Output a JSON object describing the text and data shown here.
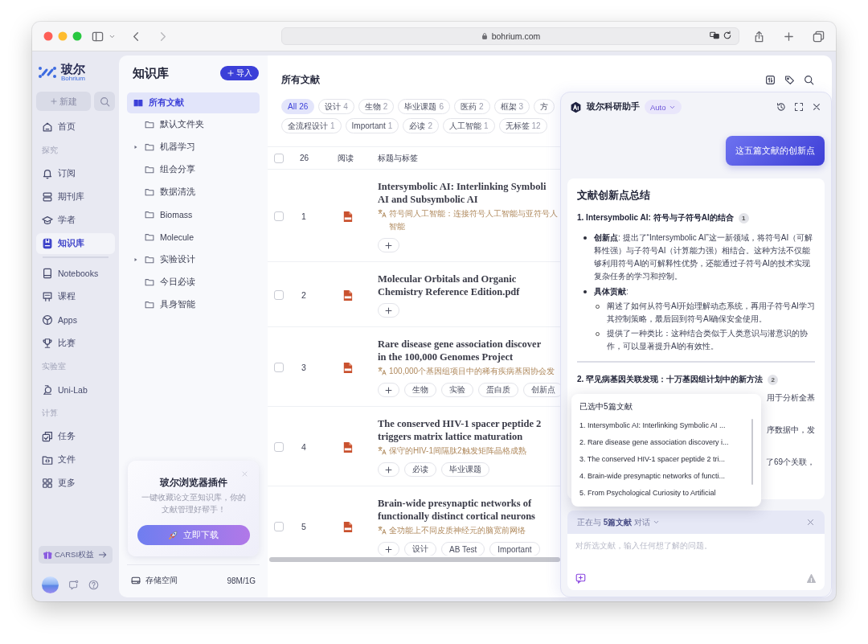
{
  "browser": {
    "url": "bohrium.com"
  },
  "nav": {
    "brand": "玻尔",
    "brand_sub": "Bohrium",
    "new_button": "新建",
    "items": [
      {
        "kind": "item",
        "label": "首页",
        "selected": false
      },
      {
        "kind": "section",
        "label": "探究"
      },
      {
        "kind": "item",
        "label": "订阅",
        "selected": false
      },
      {
        "kind": "item",
        "label": "期刊库",
        "selected": false
      },
      {
        "kind": "item",
        "label": "学者",
        "selected": false
      },
      {
        "kind": "item",
        "label": "知识库",
        "selected": true
      },
      {
        "kind": "divider"
      },
      {
        "kind": "item",
        "label": "Notebooks",
        "selected": false
      },
      {
        "kind": "item",
        "label": "课程",
        "selected": false
      },
      {
        "kind": "item",
        "label": "Apps",
        "selected": false
      },
      {
        "kind": "item",
        "label": "比赛",
        "selected": false
      },
      {
        "kind": "section",
        "label": "实验室"
      },
      {
        "kind": "item",
        "label": "Uni-Lab",
        "selected": false
      },
      {
        "kind": "section",
        "label": "计算"
      },
      {
        "kind": "item",
        "label": "任务",
        "selected": false
      },
      {
        "kind": "item",
        "label": "文件",
        "selected": false
      },
      {
        "kind": "item",
        "label": "更多",
        "selected": false
      }
    ],
    "carsi_button": "CARSI权益"
  },
  "library": {
    "title": "知识库",
    "import_button": "导入",
    "tree": [
      {
        "label": "所有文献",
        "selected": true,
        "children": [
          {
            "label": "默认文件夹",
            "selected": false,
            "expandable": false
          },
          {
            "label": "机器学习",
            "selected": false,
            "expandable": true
          },
          {
            "label": "组会分享",
            "selected": false,
            "expandable": false
          },
          {
            "label": "数据清洗",
            "selected": false,
            "expandable": false
          },
          {
            "label": "Biomass",
            "selected": false,
            "expandable": false
          },
          {
            "label": "Molecule",
            "selected": false,
            "expandable": false
          },
          {
            "label": "实验设计",
            "selected": false,
            "expandable": true
          },
          {
            "label": "今日必读",
            "selected": false,
            "expandable": false
          },
          {
            "label": "具身智能",
            "selected": false,
            "expandable": false
          }
        ]
      }
    ],
    "promo": {
      "title": "玻尔浏览器插件",
      "text": "一键收藏论文至知识库，你的文献管理好帮手！",
      "button": "立即下载"
    },
    "storage": {
      "label": "存储空间",
      "value": "98M/1G"
    }
  },
  "documents": {
    "title": "所有文献",
    "filter_rows": [
      [
        {
          "label": "All",
          "count": "26",
          "selected": true
        },
        {
          "label": "设计",
          "count": "4",
          "selected": false
        },
        {
          "label": "生物",
          "count": "2",
          "selected": false
        },
        {
          "label": "毕业课题",
          "count": "6",
          "selected": false
        },
        {
          "label": "医药",
          "count": "2",
          "selected": false
        },
        {
          "label": "框架",
          "count": "3",
          "selected": false
        },
        {
          "label": "方",
          "selected": false
        }
      ],
      [
        {
          "label": "全流程设计",
          "count": "1",
          "selected": false
        },
        {
          "label": "Important",
          "count": "1",
          "selected": false
        },
        {
          "label": "必读",
          "count": "2",
          "selected": false
        },
        {
          "label": "人工智能",
          "count": "1",
          "selected": false
        },
        {
          "label": "无标签",
          "count": "12",
          "selected": false
        }
      ]
    ],
    "table": {
      "select_all_checked": false,
      "count": "26",
      "columns": [
        "阅读",
        "标题与标签"
      ],
      "rows": [
        {
          "number": "1",
          "checked": false,
          "title_lines": [
            "Intersymbolic AI: Interlinking Symboli",
            "AI and Subsymbolic AI"
          ],
          "translation_lines": [
            "符号间人工智能：连接符号人工智能与亚符号人",
            "智能"
          ],
          "tags": []
        },
        {
          "number": "2",
          "checked": false,
          "title_lines": [
            "Molecular Orbitals and Organic",
            "Chemistry Reference Edition.pdf"
          ],
          "tags": []
        },
        {
          "number": "3",
          "checked": false,
          "title_lines": [
            "Rare disease gene association discover",
            "in the 100,000 Genomes Project"
          ],
          "translation_lines": [
            "100,000个基因组项目中的稀有疾病基因协会发"
          ],
          "tags": [
            "生物",
            "实验",
            "蛋白质",
            "创新点"
          ]
        },
        {
          "number": "4",
          "checked": false,
          "title_lines": [
            "The conserved HIV-1 spacer peptide 2",
            "triggers matrix lattice maturation"
          ],
          "translation_lines": [
            "保守的HIV-1间隔肽2触发矩阵晶格成熟"
          ],
          "tags": [
            "必读",
            "毕业课题"
          ]
        },
        {
          "number": "5",
          "checked": false,
          "title_lines": [
            "Brain-wide presynaptic networks of",
            "functionally distinct cortical neurons"
          ],
          "translation_lines": [
            "全功能上不同皮质神经元的脑宽前网络"
          ],
          "tags": [
            "设计",
            "AB Test",
            "Important"
          ]
        }
      ]
    }
  },
  "assistant": {
    "title": "玻尔科研助手",
    "mode": "Auto",
    "user_message": "这五篇文献的创新点",
    "answer": {
      "heading": "文献创新点总结",
      "sections": [
        {
          "title": "1. Intersymbolic AI: 符号与子符号AI的结合",
          "badge": "1",
          "bullets": [
            {
              "text": "**创新点**: 提出了“Intersymbolic AI”这一新领域，将符号AI（可解释性强）与子符号AI（计算能力强）相结合。这种方法不仅能够利用符号AI的可解释性优势，还能通过子符号AI的技术实现复杂任务的学习和控制。"
            },
            {
              "text": "**具体贡献**:",
              "children": [
                "阐述了如何从符号AI开始理解动态系统，再用子符号AI学习其控制策略，最后回到符号AI确保安全使用。",
                "提供了一种类比：这种结合类似于人类意识与潜意识的协作，可以显著提升AI的有效性。"
              ]
            }
          ]
        },
        {
          "title": "2. 罕见病基因关联发现：十万基因组计划中的新方法",
          "badge": "2",
          "partial_lines": [
            "用于分析全基",
            "序数据中，发",
            "了69个关联，"
          ]
        }
      ]
    },
    "selection": {
      "title": "已选中5篇文献",
      "items": [
        "1. Intersymbolic AI: Interlinking Symbolic AI ...",
        "2. Rare disease gene association discovery i...",
        "3. The conserved HIV-1 spacer peptide 2 tri...",
        "4. Brain-wide presynaptic networks of functi...",
        "5. From Psychological Curiosity to Artificial"
      ]
    },
    "context": "正在与 **5篇文献** 对话",
    "input": {
      "placeholder": "对所选文献，输入任何想了解的问题。"
    }
  }
}
